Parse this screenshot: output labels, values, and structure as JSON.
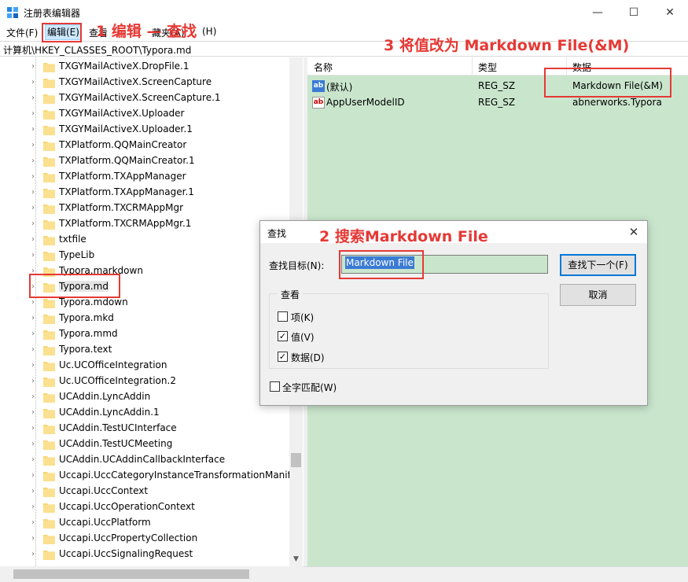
{
  "window": {
    "title": "注册表编辑器",
    "minimize_glyph": "—",
    "maximize_glyph": "☐",
    "close_glyph": "✕"
  },
  "menu": {
    "file": "文件(F)",
    "edit": "编辑(E)",
    "view": "查看",
    "favorites_partial": "藏夹(A)",
    "help": "(H)"
  },
  "address": "计算机\\HKEY_CLASSES_ROOT\\Typora.md",
  "tree": {
    "items": [
      "TXGYMailActiveX.DropFile.1",
      "TXGYMailActiveX.ScreenCapture",
      "TXGYMailActiveX.ScreenCapture.1",
      "TXGYMailActiveX.Uploader",
      "TXGYMailActiveX.Uploader.1",
      "TXPlatform.QQMainCreator",
      "TXPlatform.QQMainCreator.1",
      "TXPlatform.TXAppManager",
      "TXPlatform.TXAppManager.1",
      "TXPlatform.TXCRMAppMgr",
      "TXPlatform.TXCRMAppMgr.1",
      "txtfile",
      "TypeLib",
      "Typora.markdown",
      "Typora.md",
      "Typora.mdown",
      "Typora.mkd",
      "Typora.mmd",
      "Typora.text",
      "Uc.UCOfficeIntegration",
      "Uc.UCOfficeIntegration.2",
      "UCAddin.LyncAddin",
      "UCAddin.LyncAddin.1",
      "UCAddin.TestUCInterface",
      "UCAddin.TestUCMeeting",
      "UCAddin.UCAddinCallbackInterface",
      "Uccapi.UccCategoryInstanceTransformationManife",
      "Uccapi.UccContext",
      "Uccapi.UccOperationContext",
      "Uccapi.UccPlatform",
      "Uccapi.UccPropertyCollection",
      "Uccapi.UccSignalingRequest"
    ],
    "selected": "Typora.md"
  },
  "values": {
    "headers": {
      "name": "名称",
      "type": "类型",
      "data": "数据"
    },
    "rows": [
      {
        "name": "(默认)",
        "type": "REG_SZ",
        "data": "Markdown File(&M)"
      },
      {
        "name": "AppUserModelID",
        "type": "REG_SZ",
        "data": "abnerworks.Typora"
      }
    ]
  },
  "find_dialog": {
    "title": "查找",
    "close_glyph": "✕",
    "target_label": "查找目标(N):",
    "target_value": "Markdown File",
    "find_next": "查找下一个(F)",
    "cancel": "取消",
    "look_at": "查看",
    "keys": {
      "label": "项(K)",
      "checked": false
    },
    "values": {
      "label": "值(V)",
      "checked": true
    },
    "data": {
      "label": "数据(D)",
      "checked": true
    },
    "match_whole": {
      "label": "全字匹配(W)",
      "checked": false
    }
  },
  "annotations": {
    "step1": "1 编辑 — 查找",
    "step2": "2 搜索Markdown File",
    "step3": "3 将值改为 Markdown File(&M)",
    "color": "#e53935"
  },
  "colors": {
    "selection_bg": "#c9e6cd",
    "accent": "#0078d7"
  }
}
